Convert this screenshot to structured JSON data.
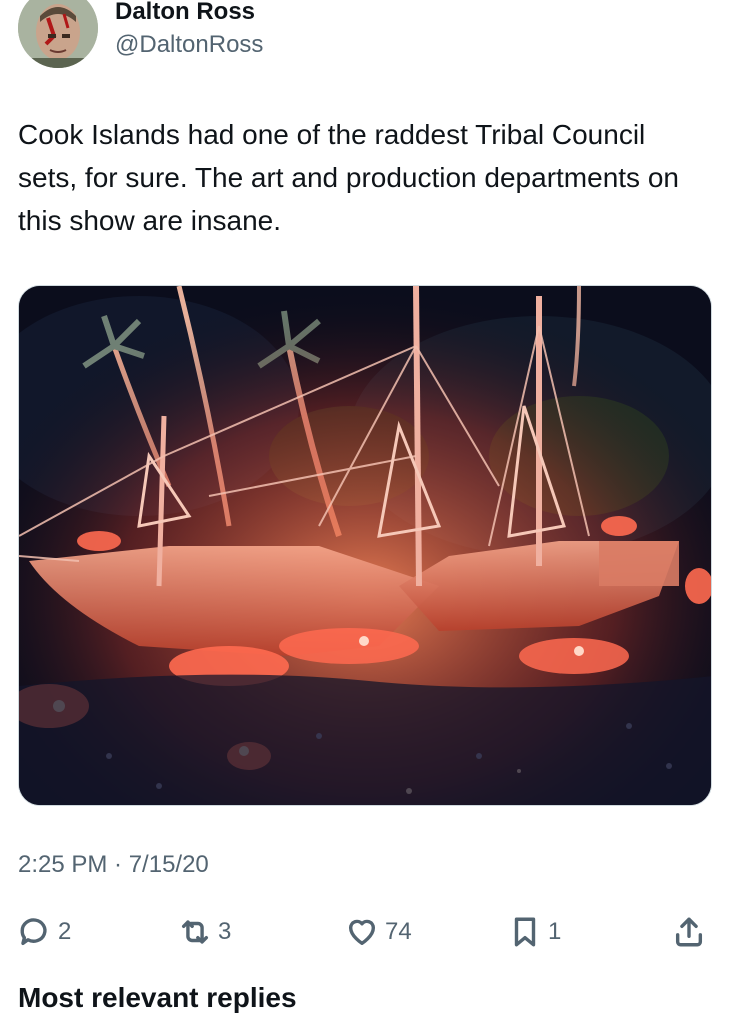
{
  "author": {
    "display_name": "Dalton Ross",
    "handle": "@DaltonRoss"
  },
  "tweet": {
    "text": "Cook Islands had one of the raddest Tribal Council sets, for sure. The art and production departments on this show are insane.",
    "timestamp": "2:25 PM · 7/15/20"
  },
  "actions": {
    "reply": {
      "icon": "reply-icon",
      "count": "2"
    },
    "retweet": {
      "icon": "retweet-icon",
      "count": "3"
    },
    "like": {
      "icon": "heart-icon",
      "count": "74"
    },
    "bookmark": {
      "icon": "bookmark-icon",
      "count": "1"
    },
    "share": {
      "icon": "share-icon"
    }
  },
  "next_section": {
    "heading": "Most relevant replies"
  }
}
